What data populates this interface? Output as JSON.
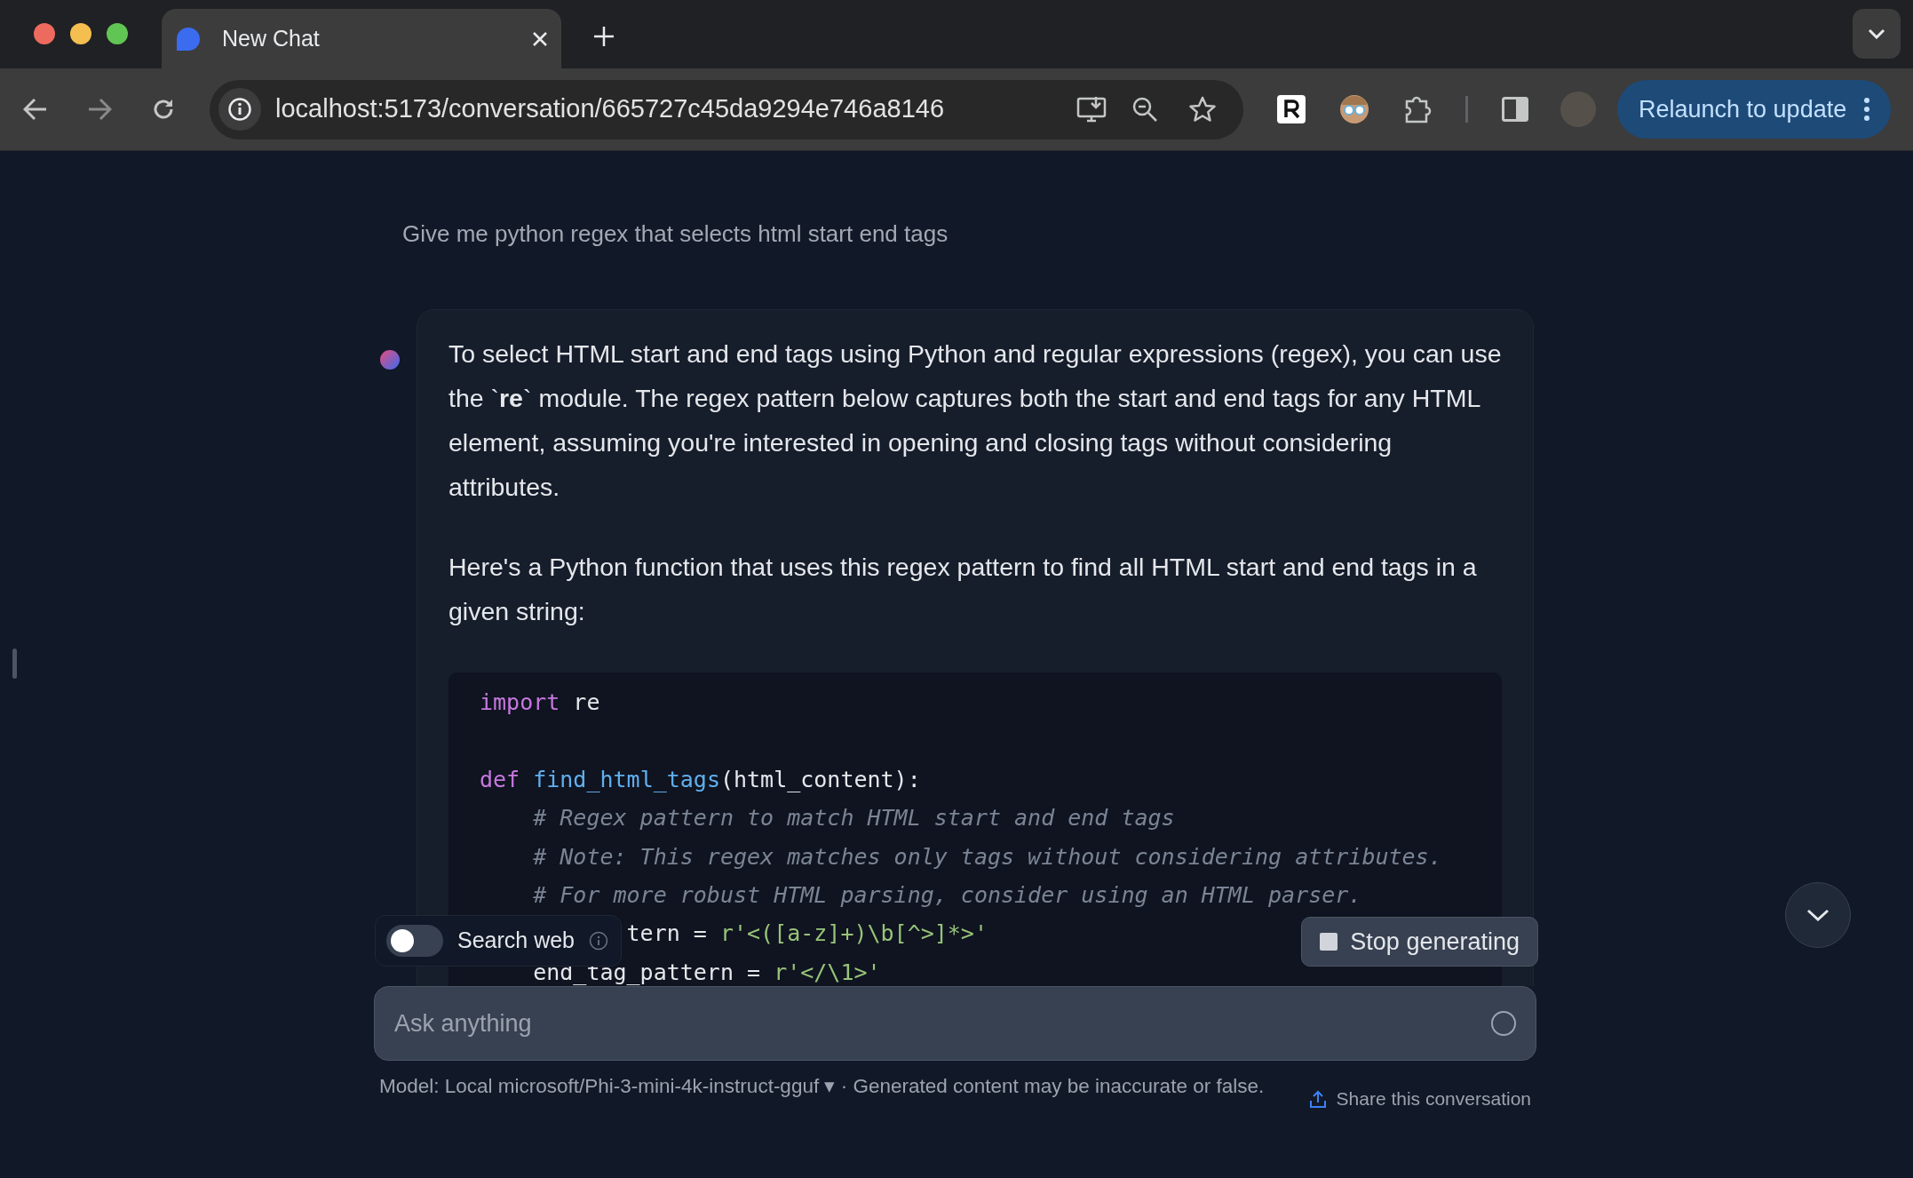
{
  "browser": {
    "tab": {
      "title": "New Chat",
      "selected": true
    },
    "url": "localhost:5173/conversation/665727c45da9294e746a8146",
    "relaunch": "Relaunch to update"
  },
  "conversation": {
    "user_message": "Give me python regex that selects html start end tags",
    "assistant_paragraphs": [
      "To select HTML start and end tags using Python and regular expressions (regex), you can use the `**re**` module. The regex pattern below captures both the start and end tags for any HTML element, assuming you're interested in opening and closing tags without considering attributes.",
      "Here's a Python function that uses this regex pattern to find all HTML start and end tags in a given string:"
    ],
    "code_lines": [
      {
        "kind": "code",
        "tokens": [
          {
            "kind": "keyword",
            "text": "import"
          },
          {
            "kind": "plain",
            "text": " re"
          }
        ]
      },
      {
        "kind": "blank"
      },
      {
        "kind": "code",
        "tokens": [
          {
            "kind": "keyword",
            "text": "def "
          },
          {
            "kind": "function",
            "text": "find_html_tags"
          },
          {
            "kind": "plain",
            "text": "(html_content):"
          }
        ]
      },
      {
        "kind": "code",
        "tokens": [
          {
            "kind": "comment",
            "text": "    # Regex pattern to match HTML start and end tags"
          }
        ]
      },
      {
        "kind": "code",
        "tokens": [
          {
            "kind": "comment",
            "text": "    # Note: This regex matches only tags without considering attributes."
          }
        ]
      },
      {
        "kind": "code",
        "tokens": [
          {
            "kind": "comment",
            "text": "    # For more robust HTML parsing, consider using an HTML parser."
          }
        ]
      },
      {
        "kind": "partial",
        "tokens": [
          {
            "kind": "plain",
            "text": "tern = "
          },
          {
            "kind": "string",
            "text": "r'<([a-z]+)\\b[^>]*>'"
          }
        ]
      },
      {
        "kind": "code",
        "tokens": [
          {
            "kind": "plain",
            "text": "    end_tag_pattern = "
          },
          {
            "kind": "string",
            "text": "r'</\\1>'"
          }
        ]
      }
    ]
  },
  "search_web": {
    "label": "Search web",
    "checked": false
  },
  "stop_button": "Stop generating",
  "input": {
    "placeholder": "Ask anything"
  },
  "footer": {
    "model": "Model: Local microsoft/Phi-3-mini-4k-instruct-gguf",
    "caret": "▾",
    "disclaimer": " · Generated content may be inaccurate or false.",
    "share": "Share this conversation"
  }
}
